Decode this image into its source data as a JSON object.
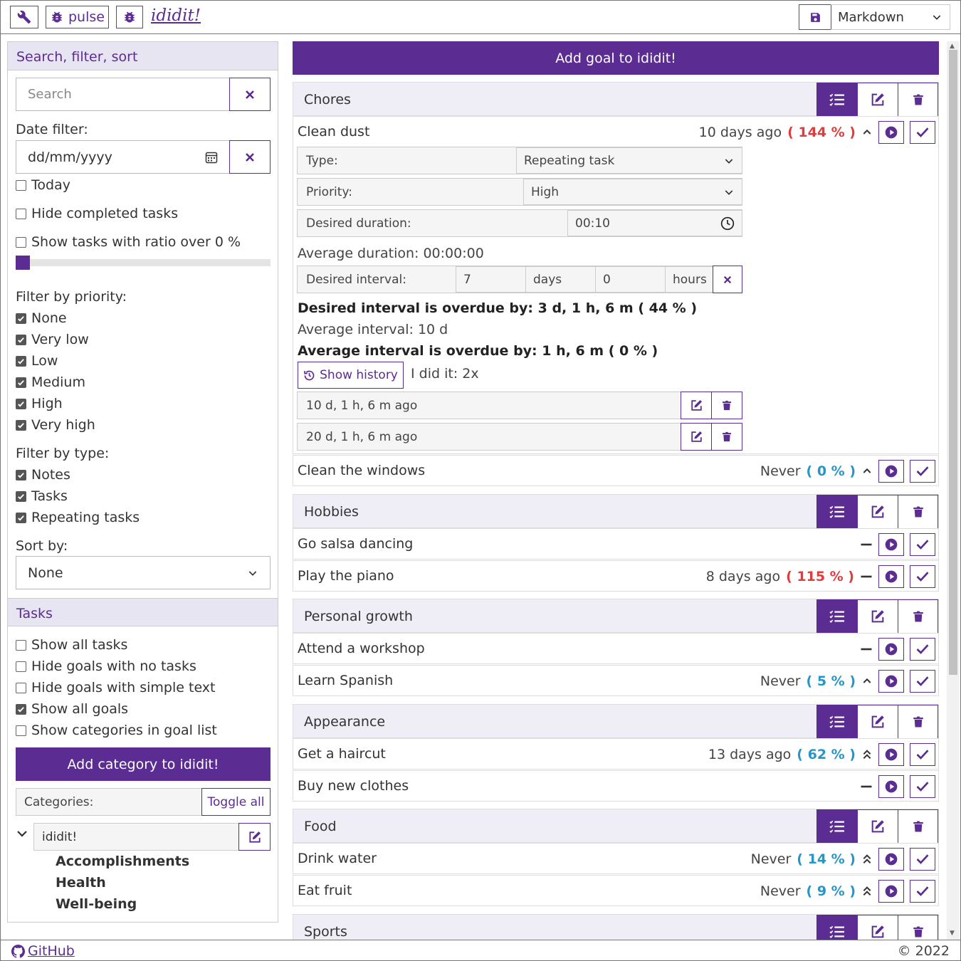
{
  "toolbar": {
    "pulse_label": "pulse",
    "brand": "ididit!",
    "format_value": "Markdown"
  },
  "sidebar": {
    "search_header": "Search, filter, sort",
    "search_placeholder": "Search",
    "date_filter_label": "Date filter:",
    "date_placeholder": "dd/mm/yyyy",
    "today": "Today",
    "hide_completed": "Hide completed tasks",
    "ratio_label": "Show tasks with ratio over 0 %",
    "ratio_value": 0,
    "priority_label": "Filter by priority:",
    "priorities": [
      "None",
      "Very low",
      "Low",
      "Medium",
      "High",
      "Very high"
    ],
    "type_label": "Filter by type:",
    "types": [
      "Notes",
      "Tasks",
      "Repeating tasks"
    ],
    "sort_label": "Sort by:",
    "sort_value": "None",
    "tasks_header": "Tasks",
    "task_options": [
      {
        "label": "Show all tasks",
        "checked": false
      },
      {
        "label": "Hide goals with no tasks",
        "checked": false
      },
      {
        "label": "Hide goals with simple text",
        "checked": false
      },
      {
        "label": "Show all goals",
        "checked": true
      },
      {
        "label": "Show categories in goal list",
        "checked": false
      }
    ],
    "add_category": "Add category to ididit!",
    "categories_label": "Categories:",
    "toggle_all": "Toggle all",
    "root_category": "ididit!",
    "subcategories": [
      "Accomplishments",
      "Health",
      "Well-being"
    ]
  },
  "main": {
    "add_goal": "Add goal to ididit!",
    "categories": [
      {
        "name": "Chores"
      },
      {
        "name": "Hobbies"
      },
      {
        "name": "Personal growth"
      },
      {
        "name": "Appearance"
      },
      {
        "name": "Food"
      },
      {
        "name": "Sports"
      }
    ],
    "goals": {
      "clean_dust": {
        "name": "Clean dust",
        "when": "10 days ago",
        "ratio": "( 144 % )"
      },
      "clean_windows": {
        "name": "Clean the windows",
        "when": "Never",
        "ratio": "( 0 % )"
      },
      "salsa": {
        "name": "Go salsa dancing"
      },
      "piano": {
        "name": "Play the piano",
        "when": "8 days ago",
        "ratio": "( 115 % )"
      },
      "workshop": {
        "name": "Attend a workshop"
      },
      "spanish": {
        "name": "Learn Spanish",
        "when": "Never",
        "ratio": "( 5 % )"
      },
      "haircut": {
        "name": "Get a haircut",
        "when": "13 days ago",
        "ratio": "( 62 % )"
      },
      "clothes": {
        "name": "Buy new clothes"
      },
      "water": {
        "name": "Drink water",
        "when": "Never",
        "ratio": "( 14 % )"
      },
      "fruit": {
        "name": "Eat fruit",
        "when": "Never",
        "ratio": "( 9 % )"
      }
    },
    "detail": {
      "type_label": "Type:",
      "type_value": "Repeating task",
      "priority_label": "Priority:",
      "priority_value": "High",
      "duration_label": "Desired duration:",
      "duration_value": "00:10",
      "avg_duration": "Average duration: 00:00:00",
      "interval_label": "Desired interval:",
      "interval_days": "7",
      "days_unit": "days",
      "interval_hours": "0",
      "hours_unit": "hours",
      "overdue": "Desired interval is overdue by: 3 d, 1 h, 6 m ( 44 % )",
      "avg_interval": "Average interval: 10 d",
      "avg_overdue": "Average interval is overdue by: 1 h, 6 m ( 0 % )",
      "show_history": "Show history",
      "did_it": "I did it: 2x",
      "history": [
        "10 d, 1 h, 6 m ago",
        "20 d, 1 h, 6 m ago"
      ]
    }
  },
  "footer": {
    "github": "GitHub",
    "copyright": "© 2022"
  }
}
